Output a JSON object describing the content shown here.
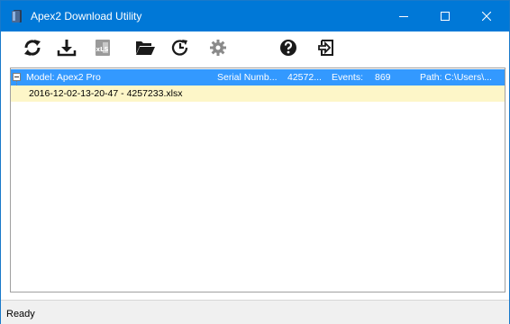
{
  "window": {
    "title": "Apex2 Download Utility",
    "titlebar_color": "#0078d7",
    "controls": [
      "minimize-icon",
      "maximize-icon",
      "close-icon"
    ]
  },
  "toolbar": {
    "tools": [
      {
        "name": "refresh",
        "icon": "refresh-icon"
      },
      {
        "name": "download",
        "icon": "download-icon"
      },
      {
        "name": "export-excel",
        "icon": "excel-icon"
      },
      {
        "name": "open-folder",
        "icon": "folder-open-icon"
      },
      {
        "name": "history",
        "icon": "clock-icon"
      },
      {
        "name": "settings",
        "icon": "gear-icon"
      },
      {
        "name": "help",
        "icon": "help-icon"
      },
      {
        "name": "exit",
        "icon": "exit-icon"
      }
    ]
  },
  "tree": {
    "device": {
      "model": "Model: Apex2 Pro",
      "serial": "Serial Numb...",
      "serial_value": "42572...",
      "events": "Events:",
      "events_value": "869",
      "path": "Path: C:\\Users\\..."
    },
    "file": {
      "name": "2016-12-02-13-20-47 - 4257233.xlsx"
    },
    "selected_color": "#3399ff",
    "highlight_color": "#fdf6c8"
  },
  "status": {
    "text": "Ready"
  }
}
